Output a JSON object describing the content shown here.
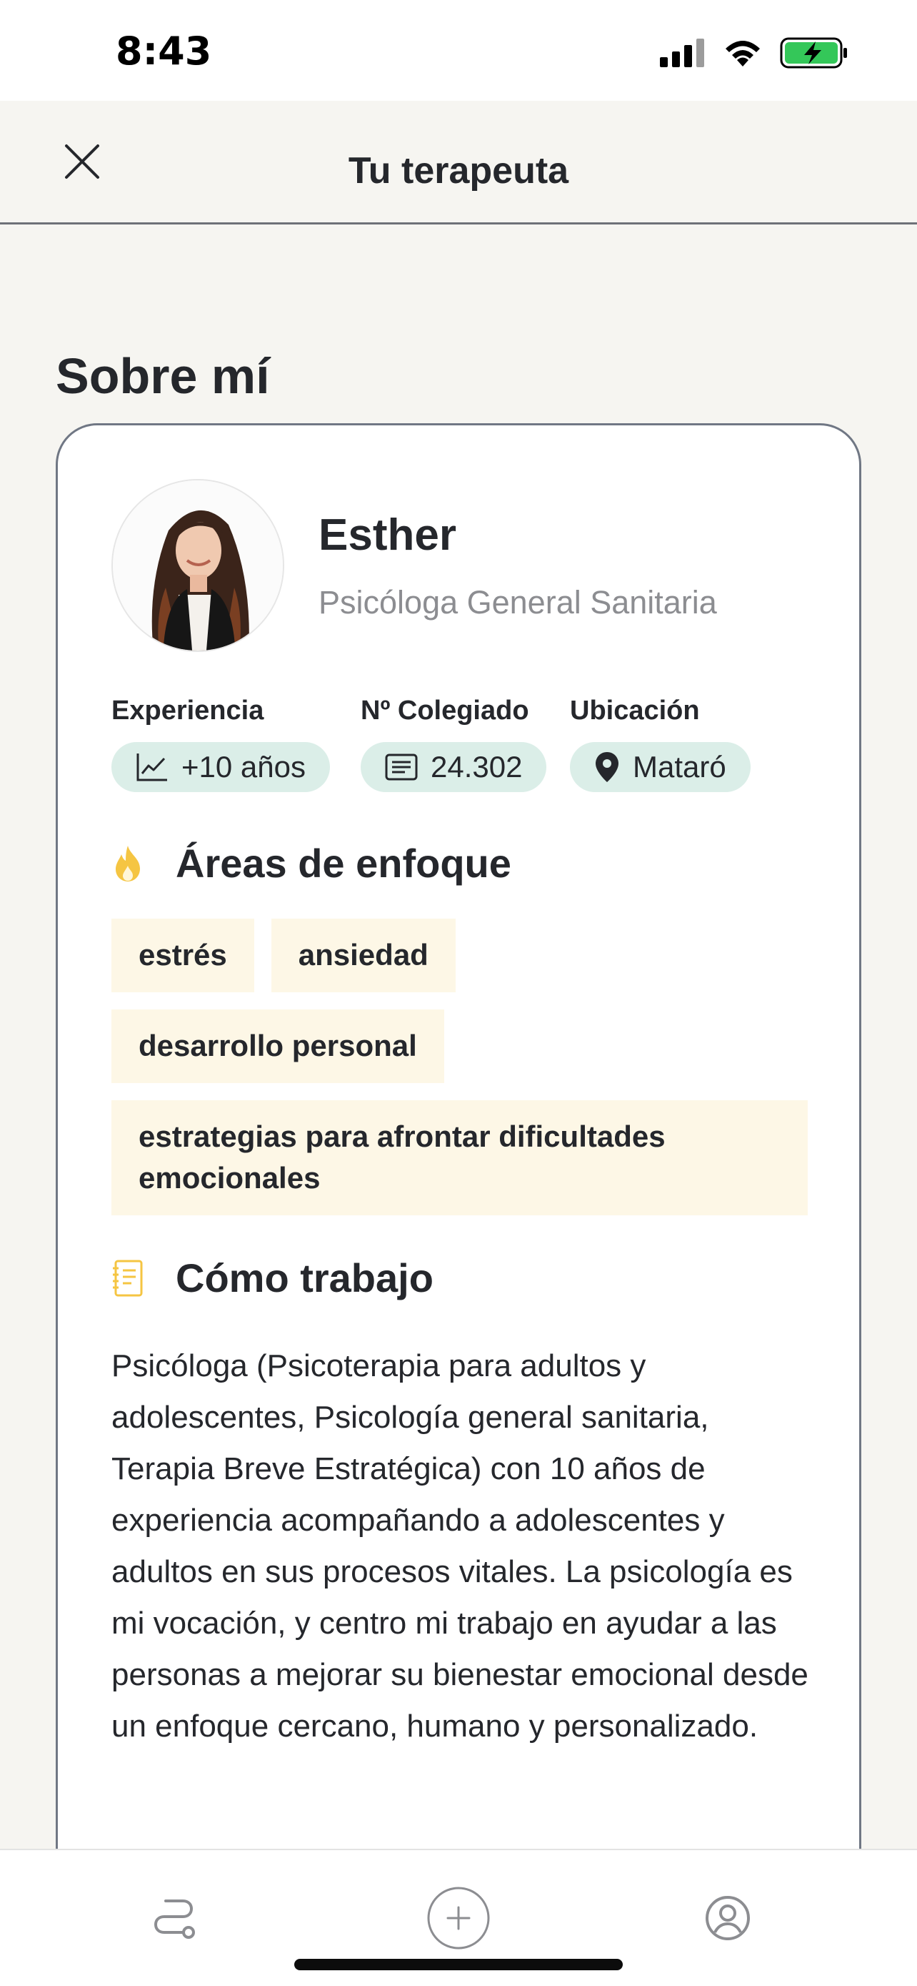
{
  "status_bar": {
    "time": "8:43"
  },
  "header": {
    "title": "Tu terapeuta"
  },
  "section": {
    "title": "Sobre mí"
  },
  "therapist": {
    "name": "Esther",
    "role": "Psicóloga General Sanitaria"
  },
  "stats": [
    {
      "label": "Experiencia",
      "value": "+10 años",
      "icon": "chart-icon"
    },
    {
      "label": "Nº Colegiado",
      "value": "24.302",
      "icon": "document-icon"
    },
    {
      "label": "Ubicación",
      "value": "Mataró",
      "icon": "location-pin-icon"
    }
  ],
  "focus": {
    "title": "Áreas de enfoque",
    "icon": "flame-icon",
    "tags": [
      "estrés",
      "ansiedad",
      "desarrollo personal",
      "estrategias para afrontar dificultades emocionales"
    ]
  },
  "work": {
    "title": "Cómo trabajo",
    "icon": "notebook-icon",
    "description": "Psicóloga (Psicoterapia para adultos y adolescentes, Psicología general sanitaria, Terapia Breve Estratégica) con 10 años de experiencia acompañando a adolescentes y adultos en sus procesos vitales. La psicología es mi vocación, y centro mi trabajo en ayudar a las personas a mejorar su bienestar emocional desde un enfoque cercano, humano y personalizado."
  },
  "tab_bar": {
    "items": [
      "journey-icon",
      "add-circle-icon",
      "profile-icon"
    ]
  },
  "colors": {
    "background": "#f6f5f1",
    "chip_bg": "#dbeee8",
    "tag_bg": "#fdf7e6",
    "accent_yellow": "#f5c542",
    "text": "#25272c",
    "muted": "#8c8d91"
  }
}
